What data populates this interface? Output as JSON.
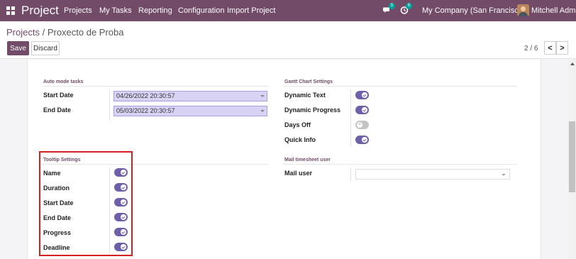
{
  "navbar": {
    "brand": "Project",
    "menu": [
      "Projects",
      "My Tasks",
      "Reporting",
      "Configuration",
      "Import Project"
    ],
    "messages_count": "5",
    "activities_count": "6",
    "company": "My Company (San Francisco)",
    "user": "Mitchell Admin"
  },
  "breadcrumb": {
    "parent": "Projects",
    "separator": " / ",
    "current": "Proxecto de Proba"
  },
  "actions": {
    "save": "Save",
    "discard": "Discard"
  },
  "pager": {
    "value": "2 / 6",
    "prev": "<",
    "next": ">"
  },
  "auto_mode": {
    "title": "Auto mode tasks",
    "start_label": "Start Date",
    "start_value": "04/26/2022 20:30:57",
    "end_label": "End Date",
    "end_value": "05/03/2022 20:30:57"
  },
  "gantt": {
    "title": "Gantt Chart Settings",
    "items": [
      {
        "label": "Dynamic Text",
        "on": true
      },
      {
        "label": "Dynamic Progress",
        "on": true
      },
      {
        "label": "Days Off",
        "on": false
      },
      {
        "label": "Quick Info",
        "on": true
      }
    ]
  },
  "tooltip": {
    "title": "Tooltip Settings",
    "items": [
      {
        "label": "Name",
        "on": true
      },
      {
        "label": "Duration",
        "on": true
      },
      {
        "label": "Start Date",
        "on": true
      },
      {
        "label": "End Date",
        "on": true
      },
      {
        "label": "Progress",
        "on": true
      },
      {
        "label": "Deadline",
        "on": true
      }
    ]
  },
  "mail": {
    "title": "Mail timesheet user",
    "user_label": "Mail user",
    "user_value": ""
  },
  "colors": {
    "navbar": "#714b67",
    "toggle_on": "#6f5fa8",
    "toggle_off": "#c4c4c4",
    "date_input_bg": "#d8d3f5",
    "highlight": "#d42020"
  },
  "icons": {
    "apps": "apps-grid-icon",
    "messages": "chat-bubbles-icon",
    "activities": "clock-icon",
    "avatar": "user-avatar"
  }
}
